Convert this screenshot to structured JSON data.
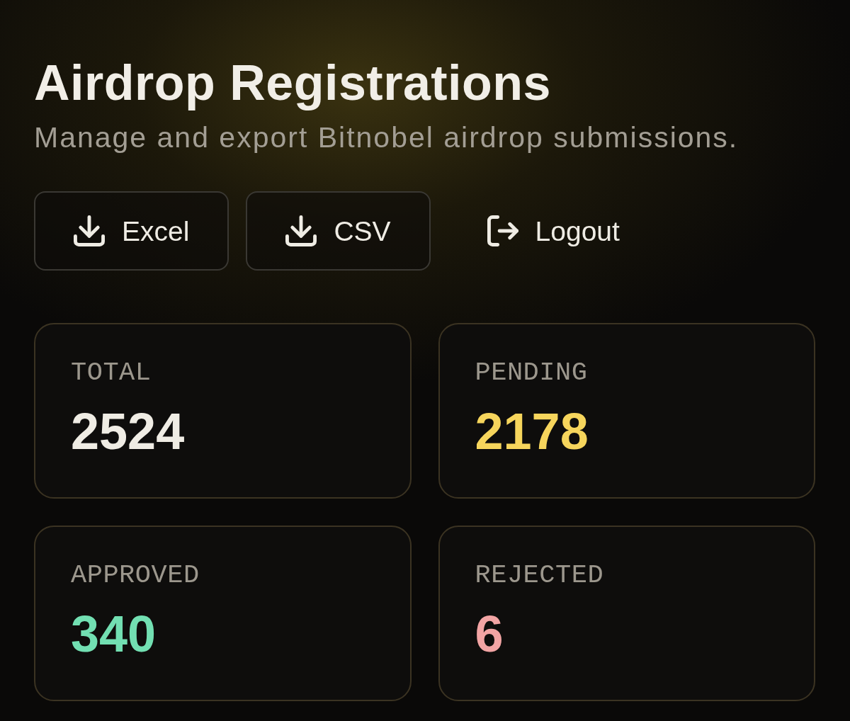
{
  "header": {
    "title": "Airdrop Registrations",
    "subtitle": "Manage and export Bitnobel airdrop submissions."
  },
  "actions": [
    {
      "label": "Excel",
      "kind": "export"
    },
    {
      "label": "CSV",
      "kind": "export"
    },
    {
      "label": "Logout",
      "kind": "logout"
    }
  ],
  "stats": [
    {
      "label": "TOTAL",
      "value": "2524",
      "color": "#efece4"
    },
    {
      "label": "PENDING",
      "value": "2178",
      "color": "#f6d55c"
    },
    {
      "label": "APPROVED",
      "value": "340",
      "color": "#72dfb2"
    },
    {
      "label": "REJECTED",
      "value": "6",
      "color": "#f2a4a4"
    }
  ]
}
